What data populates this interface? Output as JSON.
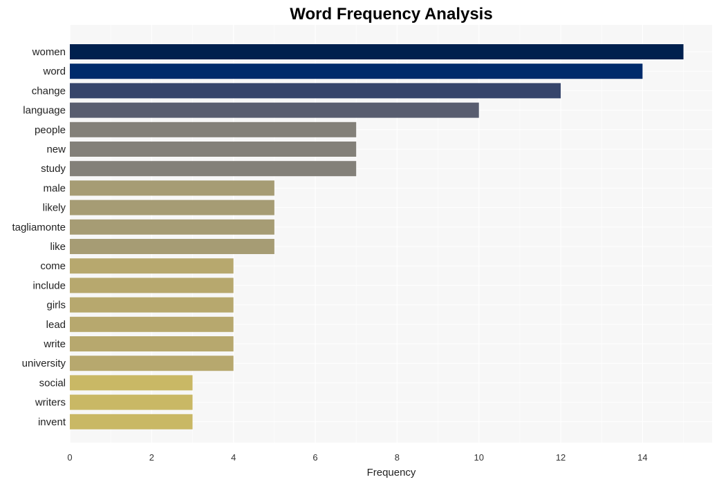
{
  "chart_data": {
    "type": "bar",
    "orientation": "horizontal",
    "title": "Word Frequency Analysis",
    "xlabel": "Frequency",
    "ylabel": "",
    "xlim": [
      0,
      15.7
    ],
    "xticks": [
      0,
      2,
      4,
      6,
      8,
      10,
      12,
      14
    ],
    "grid": true,
    "legend": "none",
    "categories": [
      "women",
      "word",
      "change",
      "language",
      "people",
      "new",
      "study",
      "male",
      "likely",
      "tagliamonte",
      "like",
      "come",
      "include",
      "girls",
      "lead",
      "write",
      "university",
      "social",
      "writers",
      "invent"
    ],
    "values": [
      15,
      14,
      12,
      10,
      7,
      7,
      7,
      5,
      5,
      5,
      5,
      4,
      4,
      4,
      4,
      4,
      4,
      3,
      3,
      3
    ],
    "colors": [
      "#00204e",
      "#002b6b",
      "#36456b",
      "#585d6f",
      "#838079",
      "#838079",
      "#838079",
      "#a69c74",
      "#a69c74",
      "#a69c74",
      "#a69c74",
      "#b7a86e",
      "#b7a86e",
      "#b7a86e",
      "#b7a86e",
      "#b7a86e",
      "#b7a86e",
      "#c9b865",
      "#c9b865",
      "#c9b865"
    ]
  },
  "style": {
    "plot_background": "#f7f7f7",
    "grid_color": "#ffffff"
  }
}
